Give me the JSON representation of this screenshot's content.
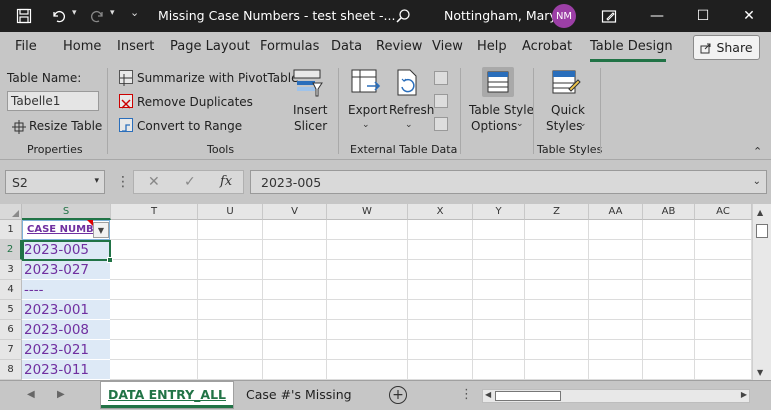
{
  "titlebar": {
    "title": "Missing Case Numbers - test sheet  -...",
    "user": "Nottingham, Mary",
    "avatar_initials": "NM",
    "minimize": "—",
    "maximize": "☐",
    "close": "✕"
  },
  "menu": {
    "items": [
      "File",
      "Home",
      "Insert",
      "Page Layout",
      "Formulas",
      "Data",
      "Review",
      "View",
      "Help",
      "Acrobat",
      "Table Design"
    ],
    "active": "Table Design",
    "share_label": "Share"
  },
  "ribbon": {
    "properties": {
      "table_name_label": "Table Name:",
      "table_name_value": "Tabelle1",
      "resize_table": "Resize Table",
      "group_label": "Properties"
    },
    "tools": {
      "summarize": "Summarize with PivotTable",
      "remove_duplicates": "Remove Duplicates",
      "convert_to_range": "Convert to Range",
      "insert_slicer_1": "Insert",
      "insert_slicer_2": "Slicer",
      "group_label": "Tools"
    },
    "external": {
      "export": "Export",
      "refresh": "Refresh",
      "group_label": "External Table Data"
    },
    "style_options": {
      "label_1": "Table Style",
      "label_2": "Options"
    },
    "table_styles": {
      "quick_1": "Quick",
      "quick_2": "Styles",
      "group_label": "Table Styles"
    }
  },
  "formula_bar": {
    "name_box": "S2",
    "value": "2023-005",
    "fx": "fx",
    "cancel": "✕",
    "enter": "✓"
  },
  "grid": {
    "columns": [
      "S",
      "T",
      "U",
      "V",
      "W",
      "X",
      "Y",
      "Z",
      "AA",
      "AB",
      "AC"
    ],
    "rows": [
      "1",
      "2",
      "3",
      "4",
      "5",
      "6",
      "7",
      "8"
    ],
    "header_cell": "CASE NUMB",
    "values": [
      "2023-005",
      "2023-027",
      "----",
      "2023-001",
      "2023-008",
      "2023-021",
      "2023-011"
    ]
  },
  "sheets": {
    "tabs": [
      "DATA ENTRY_ALL",
      "Case #'s Missing"
    ],
    "active": "DATA ENTRY_ALL",
    "add_label": "+"
  },
  "colors": {
    "accent": "#217346",
    "text_purple": "#7030a0",
    "table_fill": "#dde9f6",
    "titlebar": "#1f1f1f",
    "avatar": "#9c3fa6"
  }
}
